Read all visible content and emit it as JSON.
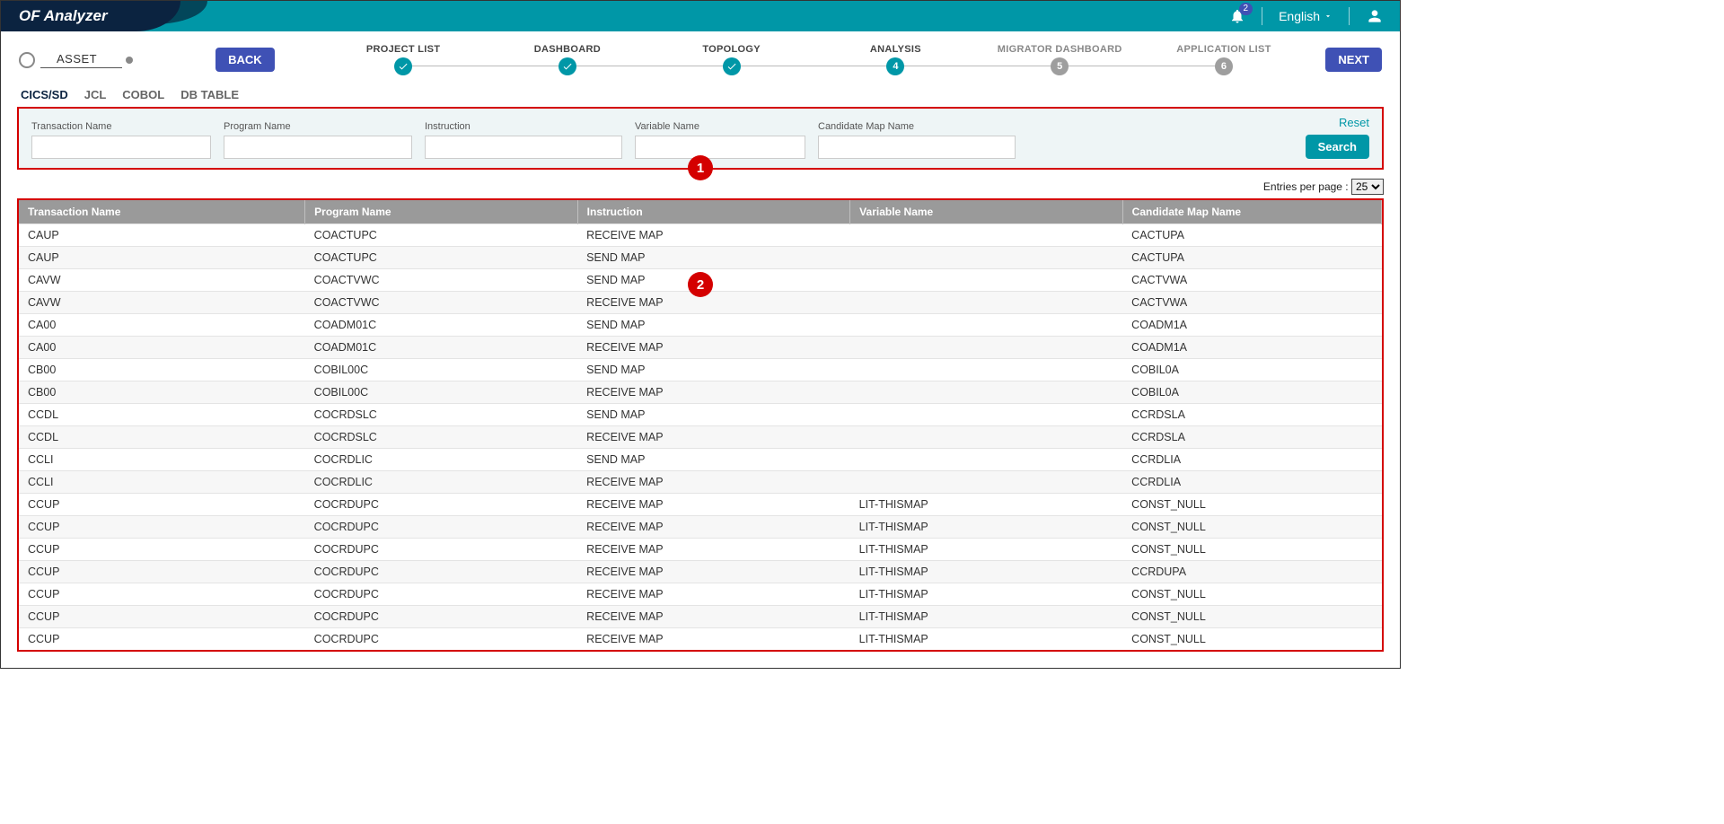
{
  "brand": "OF Analyzer",
  "notifications": {
    "count": "2"
  },
  "language": "English",
  "nav": {
    "asset": "ASSET",
    "back": "BACK",
    "next": "NEXT",
    "steps": [
      {
        "label": "PROJECT LIST",
        "state": "done"
      },
      {
        "label": "DASHBOARD",
        "state": "done"
      },
      {
        "label": "TOPOLOGY",
        "state": "done"
      },
      {
        "label": "ANALYSIS",
        "state": "active",
        "num": "4"
      },
      {
        "label": "MIGRATOR DASHBOARD",
        "state": "todo",
        "num": "5"
      },
      {
        "label": "APPLICATION LIST",
        "state": "todo",
        "num": "6"
      }
    ]
  },
  "tabs": [
    "CICS/SD",
    "JCL",
    "COBOL",
    "DB TABLE"
  ],
  "filters": {
    "labels": {
      "transaction": "Transaction Name",
      "program": "Program Name",
      "instruction": "Instruction",
      "variable": "Variable Name",
      "map": "Candidate Map Name"
    },
    "reset": "Reset",
    "search": "Search"
  },
  "annotations": {
    "one": "1",
    "two": "2"
  },
  "entriesLabel": "Entries per page :",
  "entriesValue": "25",
  "table": {
    "headers": {
      "transaction": "Transaction Name",
      "program": "Program Name",
      "instruction": "Instruction",
      "variable": "Variable Name",
      "map": "Candidate Map Name"
    },
    "rows": [
      {
        "tn": "CAUP",
        "pn": "COACTUPC",
        "in": "RECEIVE MAP",
        "vn": "",
        "cm": "CACTUPA"
      },
      {
        "tn": "CAUP",
        "pn": "COACTUPC",
        "in": "SEND MAP",
        "vn": "",
        "cm": "CACTUPA"
      },
      {
        "tn": "CAVW",
        "pn": "COACTVWC",
        "in": "SEND MAP",
        "vn": "",
        "cm": "CACTVWA"
      },
      {
        "tn": "CAVW",
        "pn": "COACTVWC",
        "in": "RECEIVE MAP",
        "vn": "",
        "cm": "CACTVWA"
      },
      {
        "tn": "CA00",
        "pn": "COADM01C",
        "in": "SEND MAP",
        "vn": "",
        "cm": "COADM1A"
      },
      {
        "tn": "CA00",
        "pn": "COADM01C",
        "in": "RECEIVE MAP",
        "vn": "",
        "cm": "COADM1A"
      },
      {
        "tn": "CB00",
        "pn": "COBIL00C",
        "in": "SEND MAP",
        "vn": "",
        "cm": "COBIL0A"
      },
      {
        "tn": "CB00",
        "pn": "COBIL00C",
        "in": "RECEIVE MAP",
        "vn": "",
        "cm": "COBIL0A"
      },
      {
        "tn": "CCDL",
        "pn": "COCRDSLC",
        "in": "SEND MAP",
        "vn": "",
        "cm": "CCRDSLA"
      },
      {
        "tn": "CCDL",
        "pn": "COCRDSLC",
        "in": "RECEIVE MAP",
        "vn": "",
        "cm": "CCRDSLA"
      },
      {
        "tn": "CCLI",
        "pn": "COCRDLIC",
        "in": "SEND MAP",
        "vn": "",
        "cm": "CCRDLIA"
      },
      {
        "tn": "CCLI",
        "pn": "COCRDLIC",
        "in": "RECEIVE MAP",
        "vn": "",
        "cm": "CCRDLIA"
      },
      {
        "tn": "CCUP",
        "pn": "COCRDUPC",
        "in": "RECEIVE MAP",
        "vn": "LIT-THISMAP",
        "cm": "CONST_NULL"
      },
      {
        "tn": "CCUP",
        "pn": "COCRDUPC",
        "in": "RECEIVE MAP",
        "vn": "LIT-THISMAP",
        "cm": "CONST_NULL"
      },
      {
        "tn": "CCUP",
        "pn": "COCRDUPC",
        "in": "RECEIVE MAP",
        "vn": "LIT-THISMAP",
        "cm": "CONST_NULL"
      },
      {
        "tn": "CCUP",
        "pn": "COCRDUPC",
        "in": "RECEIVE MAP",
        "vn": "LIT-THISMAP",
        "cm": "CCRDUPA"
      },
      {
        "tn": "CCUP",
        "pn": "COCRDUPC",
        "in": "RECEIVE MAP",
        "vn": "LIT-THISMAP",
        "cm": "CONST_NULL"
      },
      {
        "tn": "CCUP",
        "pn": "COCRDUPC",
        "in": "RECEIVE MAP",
        "vn": "LIT-THISMAP",
        "cm": "CONST_NULL"
      },
      {
        "tn": "CCUP",
        "pn": "COCRDUPC",
        "in": "RECEIVE MAP",
        "vn": "LIT-THISMAP",
        "cm": "CONST_NULL"
      }
    ]
  }
}
